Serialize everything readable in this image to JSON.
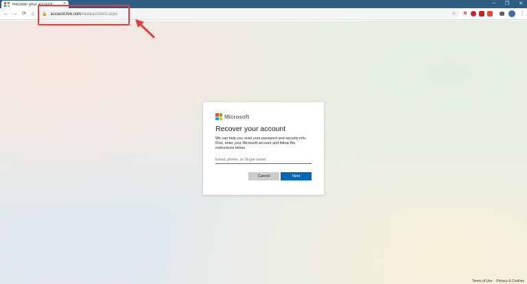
{
  "browser": {
    "tab_title": "Recover your account",
    "tab_close": "×",
    "window_controls": [
      "–",
      "❐",
      "✕"
    ],
    "url_host": "account.live.com",
    "url_path": "/newpassword.aspx",
    "nav": {
      "back": "←",
      "forward": "→",
      "reload": "⟳",
      "home": "⌂"
    },
    "star": "☆",
    "menu": "⋮",
    "extensions": [
      {
        "name": "gmail-icon",
        "color": "#d93025",
        "glyph": "M"
      },
      {
        "name": "opera-icon",
        "color": "#cc1f2f",
        "glyph": "O"
      },
      {
        "name": "extension-red-icon",
        "color": "#c5221f",
        "glyph": ""
      },
      {
        "name": "extension-red2-icon",
        "color": "#ea4335",
        "glyph": ""
      },
      {
        "name": "extension-dark-icon",
        "color": "#5f6368",
        "glyph": ""
      }
    ]
  },
  "ms_logo_colors": [
    "#f25022",
    "#7fba00",
    "#00a4ef",
    "#ffb900"
  ],
  "card": {
    "brand": "Microsoft",
    "title": "Recover your account",
    "description": "We can help you reset your password and security info. First, enter your Microsoft account and follow the instructions below.",
    "input_placeholder": "Email, phone, or Skype name",
    "input_value": "",
    "cancel_label": "Cancel",
    "next_label": "Next"
  },
  "footer": {
    "terms": "Terms of Use",
    "privacy": "Privacy & Cookies"
  },
  "colors": {
    "accent": "#0067b8",
    "annotation": "#e43b3b"
  }
}
